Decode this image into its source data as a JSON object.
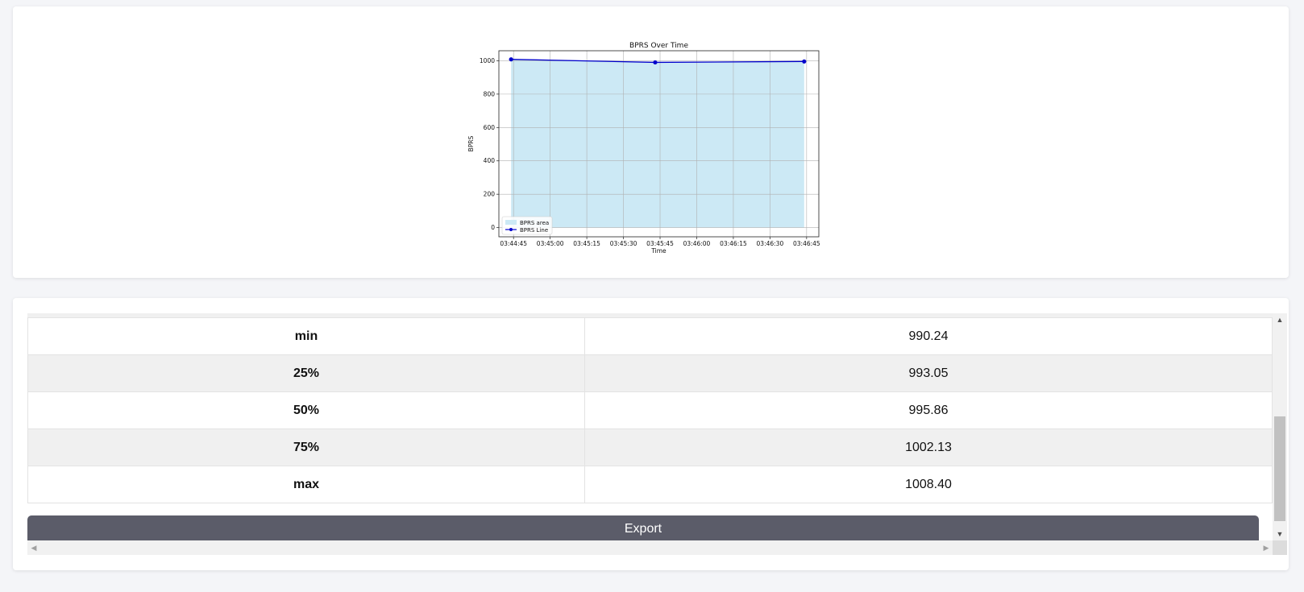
{
  "chart_data": {
    "type": "area",
    "title": "BPRS Over Time",
    "xlabel": "Time",
    "ylabel": "BPRS",
    "x": [
      "03:44:44",
      "03:45:43",
      "03:46:44"
    ],
    "series": [
      {
        "name": "BPRS area",
        "kind": "area",
        "values": [
          1008.4,
          990.24,
          995.86
        ]
      },
      {
        "name": "BPRS Line",
        "kind": "line",
        "values": [
          1008.4,
          990.24,
          995.86
        ]
      }
    ],
    "xticks": [
      "03:44:45",
      "03:45:00",
      "03:45:15",
      "03:45:30",
      "03:45:45",
      "03:46:00",
      "03:46:15",
      "03:46:30",
      "03:46:45"
    ],
    "yticks": [
      0,
      200,
      400,
      600,
      800,
      1000
    ],
    "ylim": [
      -55,
      1060
    ],
    "xlim": [
      "03:44:39",
      "03:46:50"
    ],
    "grid": true,
    "legend_position": "lower-left",
    "colors": {
      "area": "#cce9f5",
      "line": "#0000cc"
    }
  },
  "stats": {
    "rows": [
      {
        "label": "min",
        "value": "990.24"
      },
      {
        "label": "25%",
        "value": "993.05"
      },
      {
        "label": "50%",
        "value": "995.86"
      },
      {
        "label": "75%",
        "value": "1002.13"
      },
      {
        "label": "max",
        "value": "1008.40"
      }
    ]
  },
  "export": {
    "label": "Export"
  }
}
